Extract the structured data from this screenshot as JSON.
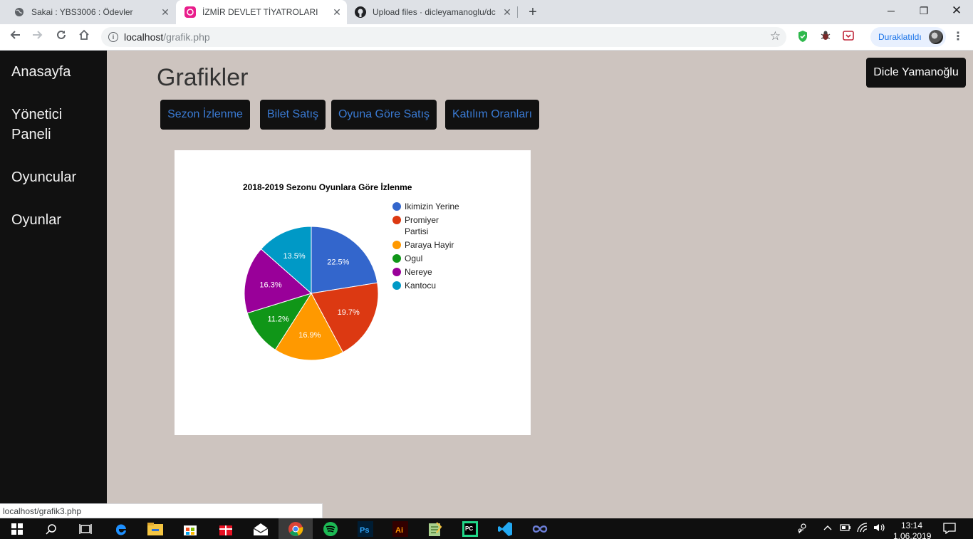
{
  "browser": {
    "tabs": [
      {
        "title": "Sakai : YBS3006 : Ödevler",
        "icon": "globe-icon",
        "active": false
      },
      {
        "title": "İZMİR DEVLET TİYATROLARI",
        "icon": "site-logo-icon",
        "active": true
      },
      {
        "title": "Upload files · dicleyamanoglu/dc",
        "icon": "github-icon",
        "active": false
      }
    ],
    "url_host": "localhost",
    "url_path": "/grafik.php",
    "profile_status": "Duraklatıldı",
    "status_bar_url": "localhost/grafik3.php"
  },
  "sidebar": {
    "items": [
      {
        "label": "Anasayfa"
      },
      {
        "label": "Yönetici Paneli"
      },
      {
        "label": "Oyuncular"
      },
      {
        "label": "Oyunlar"
      }
    ]
  },
  "main": {
    "title": "Grafikler",
    "user_button": "Dicle Yamanoğlu",
    "chart_buttons": [
      {
        "label": "Sezon İzlenme"
      },
      {
        "label": "Bilet Satış"
      },
      {
        "label": "Oyuna Göre Satış"
      },
      {
        "label": "Katılım Oranları"
      }
    ]
  },
  "chart_data": {
    "type": "pie",
    "title": "2018-2019 Sezonu Oyunlara Göre İzlenme",
    "legend_position": "right",
    "slices": [
      {
        "label": "Ikimizin Yerine",
        "percent": 22.5,
        "color": "#3366cc"
      },
      {
        "label": "Promiyer Partisi",
        "percent": 19.7,
        "color": "#dc3912"
      },
      {
        "label": "Paraya Hayir",
        "percent": 16.9,
        "color": "#ff9900"
      },
      {
        "label": "Ogul",
        "percent": 11.2,
        "color": "#109618"
      },
      {
        "label": "Nereye",
        "percent": 16.3,
        "color": "#990099"
      },
      {
        "label": "Kantocu",
        "percent": 13.5,
        "color": "#0099c6"
      }
    ]
  },
  "taskbar": {
    "time": "13:14",
    "date": "1.06.2019"
  }
}
